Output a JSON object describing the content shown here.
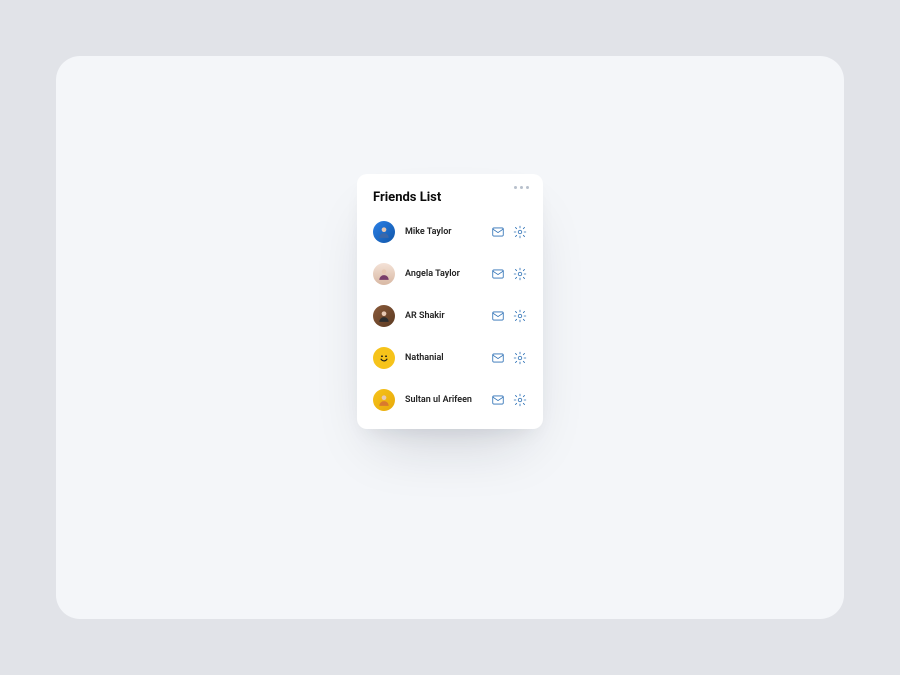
{
  "card": {
    "title": "Friends List"
  },
  "friends": [
    {
      "name": "Mike Taylor"
    },
    {
      "name": "Angela Taylor"
    },
    {
      "name": "AR Shakir"
    },
    {
      "name": "Nathanial"
    },
    {
      "name": "Sultan ul Arifeen"
    }
  ]
}
